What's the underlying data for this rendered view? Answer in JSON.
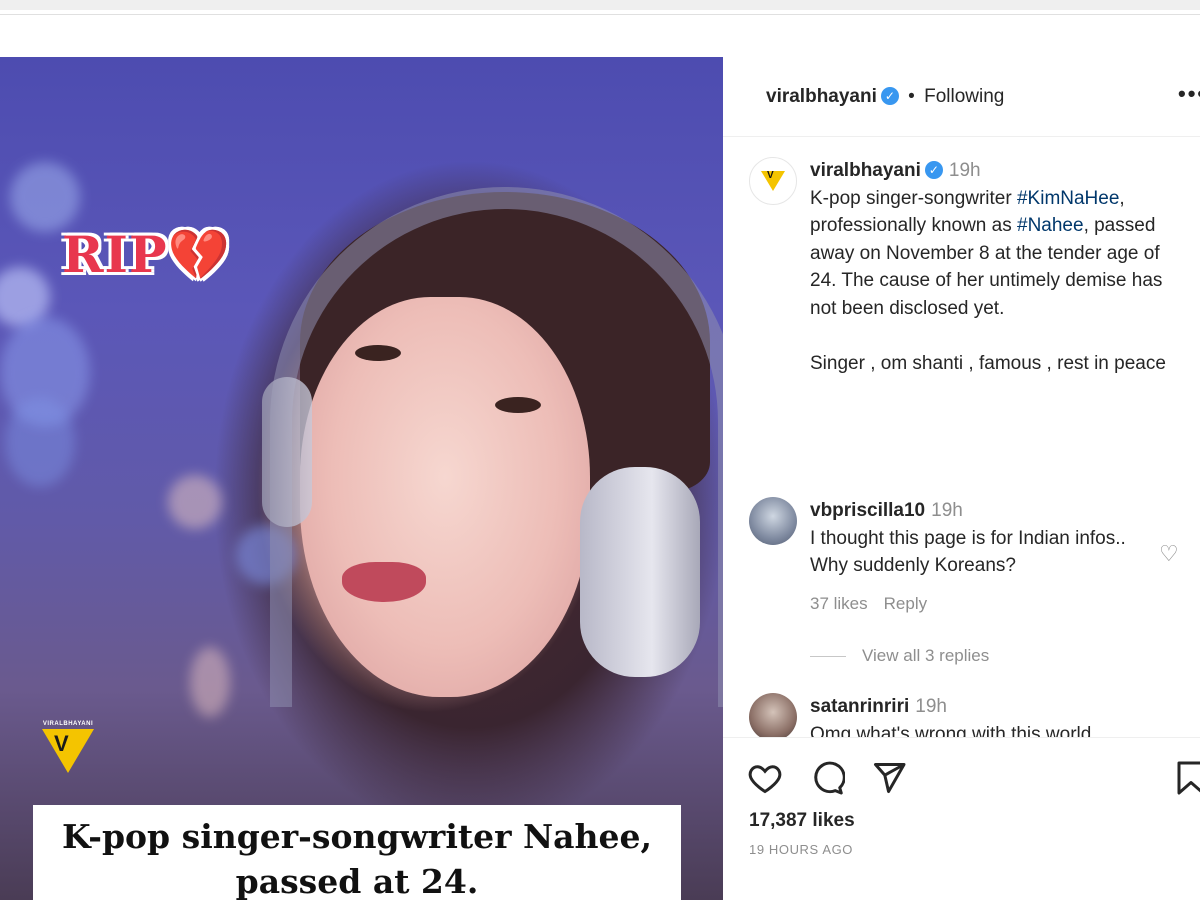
{
  "image": {
    "overlay_badge": "RIP💔",
    "watermark_text": "VIRALBHAYANI",
    "caption_line1": "K-pop singer-songwriter Nahee,",
    "caption_line2": "passed at 24."
  },
  "header": {
    "username": "viralbhayani",
    "separator": "•",
    "follow_status": "Following",
    "more_label": "•••"
  },
  "post": {
    "username": "viralbhayani",
    "time": "19h",
    "text_before_tag1": "K-pop singer-songwriter ",
    "tag1": "#KimNaHee",
    "text_between": ", professionally known as ",
    "tag2": "#Nahee",
    "text_after": ", passed away on November 8 at the tender age of 24. The cause of her untimely demise has not been disclosed yet.",
    "keywords": "Singer , om shanti , famous , rest in peace"
  },
  "comments": [
    {
      "username": "vbpriscilla10",
      "time": "19h",
      "text": "I thought this page is for Indian infos.. Why suddenly Koreans?",
      "likes": "37 likes",
      "reply_label": "Reply",
      "view_replies": "View all 3 replies"
    },
    {
      "username": "satanrinriri",
      "time": "19h",
      "text": "Omg what's wrong with this world"
    }
  ],
  "footer": {
    "likes": "17,387 likes",
    "time_ago": "19 HOURS AGO"
  },
  "icons": [
    "like-icon",
    "comment-icon",
    "share-icon",
    "save-icon",
    "verified-icon",
    "more-icon"
  ]
}
